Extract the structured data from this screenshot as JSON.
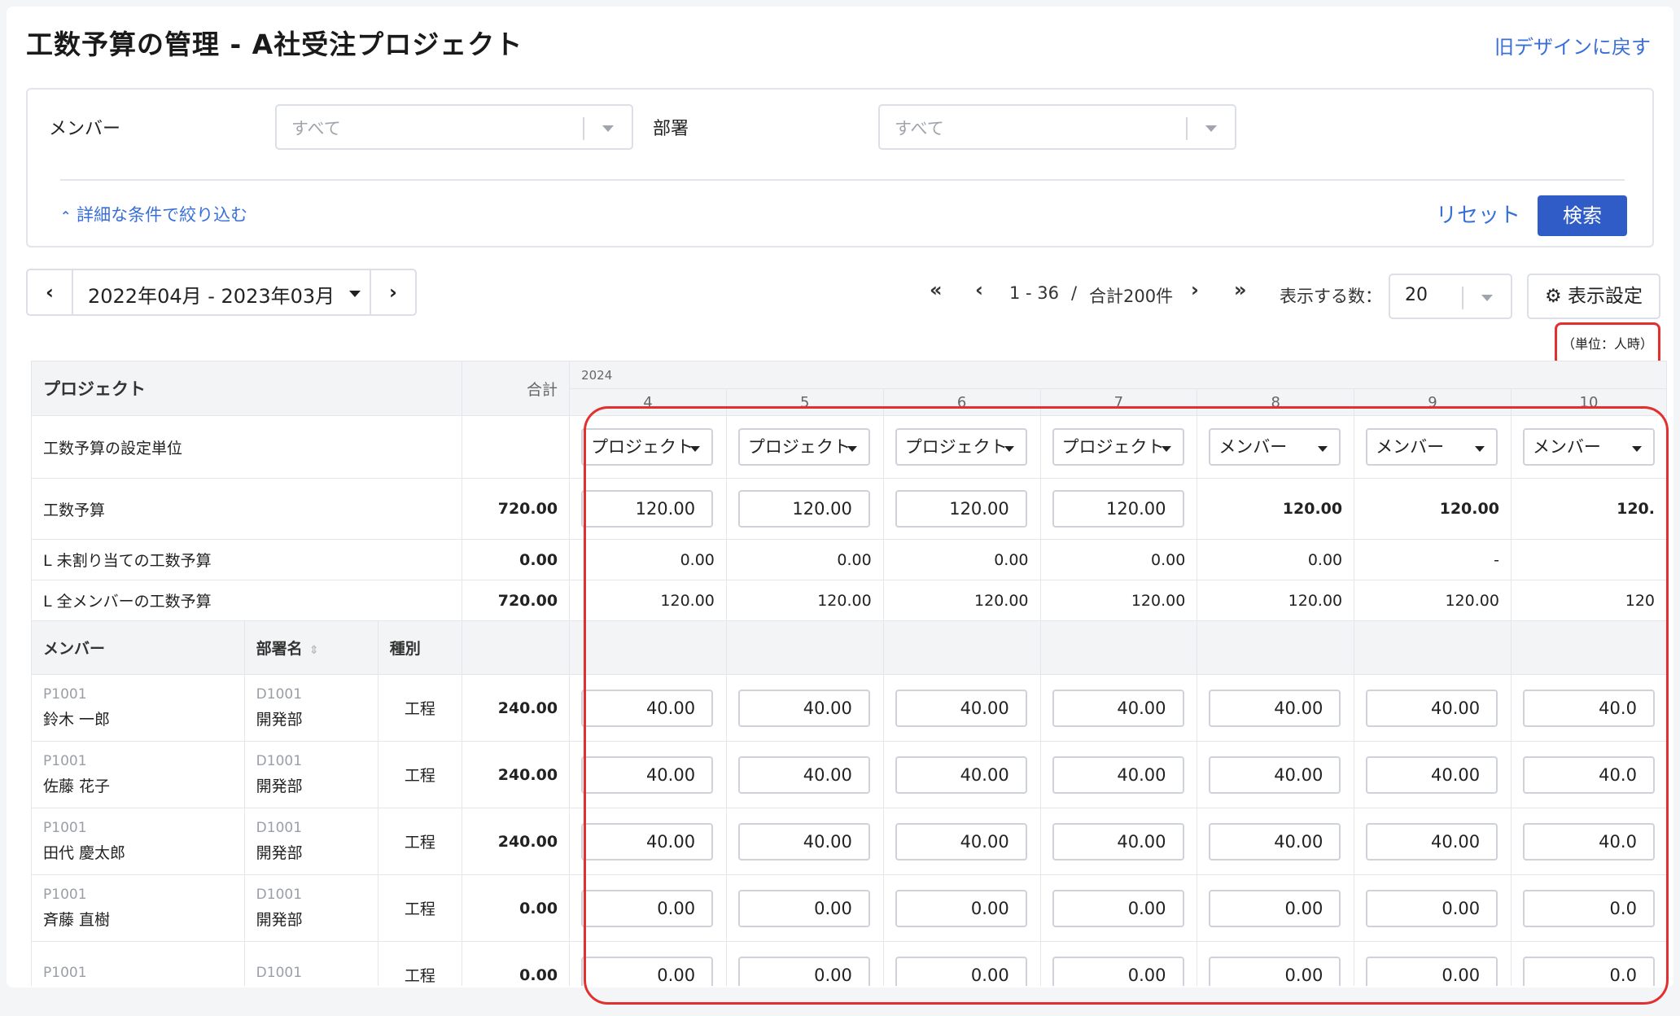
{
  "page": {
    "title": "工数予算の管理 - A社受注プロジェクト",
    "old_design_link": "旧デザインに戻す"
  },
  "filter": {
    "member_label": "メンバー",
    "member_placeholder": "すべて",
    "dept_label": "部署",
    "dept_placeholder": "すべて",
    "detail_toggle": "詳細な条件で絞り込む",
    "reset": "リセット",
    "search": "検索"
  },
  "period": {
    "label": "2022年04月 - 2023年03月"
  },
  "pagination": {
    "range": "1 - 36",
    "separator": "/",
    "total": "合計200件",
    "per_page_label": "表示する数：",
    "per_page_value": "20",
    "display_settings": "表示設定"
  },
  "unit_note": "（単位：人時）",
  "table": {
    "col_project": "プロジェクト",
    "col_total": "合計",
    "year": "2024",
    "months": [
      "4",
      "5",
      "6",
      "7",
      "8",
      "9",
      "10"
    ],
    "row_unit_label": "工数予算の設定単位",
    "unit_values": [
      "プロジェクト",
      "プロジェクト",
      "プロジェクト",
      "プロジェクト",
      "メンバー",
      "メンバー",
      "メンバー"
    ],
    "row_budget_label": "工数予算",
    "budget_total": "720.00",
    "budget_values": [
      "120.00",
      "120.00",
      "120.00",
      "120.00",
      "120.00",
      "120.00",
      "120."
    ],
    "row_unassigned_label": "L 未割り当ての工数予算",
    "unassigned_total": "0.00",
    "unassigned_values": [
      "0.00",
      "0.00",
      "0.00",
      "0.00",
      "0.00",
      "-",
      ""
    ],
    "row_allmember_label": "L 全メンバーの工数予算",
    "allmember_total": "720.00",
    "allmember_values": [
      "120.00",
      "120.00",
      "120.00",
      "120.00",
      "120.00",
      "120.00",
      "120"
    ],
    "col_member": "メンバー",
    "col_dept": "部署名",
    "col_type": "種別",
    "members": [
      {
        "code": "P1001",
        "name": "鈴木 一郎",
        "dept_code": "D1001",
        "dept": "開発部",
        "type": "工程",
        "total": "240.00",
        "values": [
          "40.00",
          "40.00",
          "40.00",
          "40.00",
          "40.00",
          "40.00",
          "40.0"
        ]
      },
      {
        "code": "P1001",
        "name": "佐藤 花子",
        "dept_code": "D1001",
        "dept": "開発部",
        "type": "工程",
        "total": "240.00",
        "values": [
          "40.00",
          "40.00",
          "40.00",
          "40.00",
          "40.00",
          "40.00",
          "40.0"
        ]
      },
      {
        "code": "P1001",
        "name": "田代 慶太郎",
        "dept_code": "D1001",
        "dept": "開発部",
        "type": "工程",
        "total": "240.00",
        "values": [
          "40.00",
          "40.00",
          "40.00",
          "40.00",
          "40.00",
          "40.00",
          "40.0"
        ]
      },
      {
        "code": "P1001",
        "name": "斉藤 直樹",
        "dept_code": "D1001",
        "dept": "開発部",
        "type": "工程",
        "total": "0.00",
        "values": [
          "0.00",
          "0.00",
          "0.00",
          "0.00",
          "0.00",
          "0.00",
          "0.0"
        ]
      },
      {
        "code": "P1001",
        "name": "",
        "dept_code": "D1001",
        "dept": "",
        "type": "工程",
        "total": "0.00",
        "values": [
          "0.00",
          "0.00",
          "0.00",
          "0.00",
          "0.00",
          "0.00",
          "0.0"
        ]
      }
    ]
  },
  "icons": {
    "chevron_up": "chevron-up-icon",
    "gear": "gear-icon",
    "sort": "sort-icon"
  }
}
